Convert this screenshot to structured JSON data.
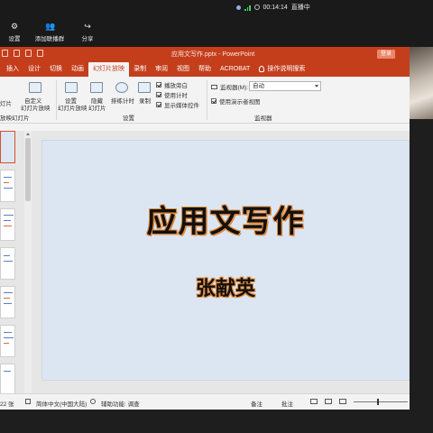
{
  "meeting": {
    "timer": "00:14:14",
    "status": "直播中",
    "tools": [
      {
        "label": "设置",
        "icon": "gear-icon",
        "glyph": "⚙"
      },
      {
        "label": "添加联播群",
        "icon": "add-group-icon",
        "glyph": "👥"
      },
      {
        "label": "分享",
        "icon": "share-icon",
        "glyph": "↪"
      }
    ]
  },
  "ppt": {
    "doc_title": "应用文写作.pptx - PowerPoint",
    "login": "登录",
    "tabs": [
      "插入",
      "设计",
      "切换",
      "动画",
      "幻灯片放映",
      "录制",
      "审阅",
      "视图",
      "帮助",
      "ACROBAT"
    ],
    "active_tab": "幻灯片放映",
    "tell_me": "操作说明搜索",
    "ribbon": {
      "cut_off_label_1": "灯片",
      "cut_off_label_2": "幻灯片",
      "custom_1": "自定义",
      "custom_2": "幻灯片放映",
      "setup_1": "设置",
      "setup_2": "幻灯片放映",
      "hide_1": "隐藏",
      "hide_2": "幻灯片",
      "rehearse": "排练计时",
      "record": "录制",
      "chk_narration": "播放旁白",
      "chk_timing": "使用计时",
      "chk_controls": "显示媒体控件",
      "group_setup": "设置",
      "monitor_label": "监视器(M):",
      "monitor_value": "自动",
      "presenter_view": "使用演示者视图",
      "group_monitors": "监视器",
      "group_left": "放映幻灯片"
    },
    "slide": {
      "title": "应用文写作",
      "subtitle": "张献英"
    },
    "status": {
      "slide_count": "22 张",
      "language": "简体中文(中国大陆)",
      "accessibility": "辅助功能: 调查",
      "notes": "备注",
      "comments": "批注"
    }
  }
}
